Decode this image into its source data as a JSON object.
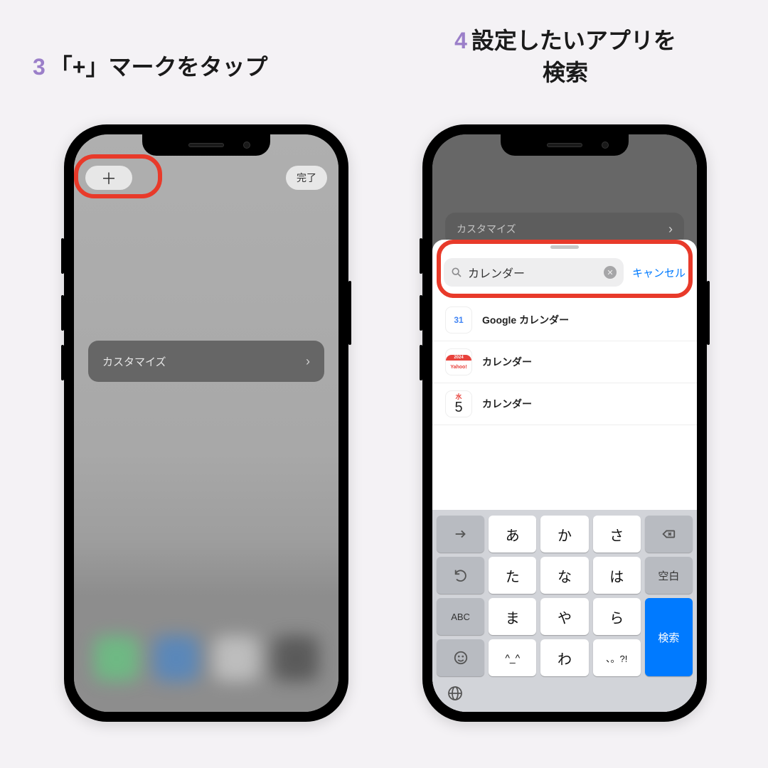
{
  "captions": {
    "step3_num": "3",
    "step3_text": "「+」マークをタップ",
    "step4_num": "4",
    "step4_text": "設定したいアプリを\n検索"
  },
  "phone1": {
    "plus_label": "＋",
    "done_label": "完了",
    "customize_label": "カスタマイズ"
  },
  "phone2": {
    "ghost_row_label": "カスタマイズ",
    "search_value": "カレンダー",
    "cancel_label": "キャンセル",
    "results": [
      {
        "label": "Google カレンダー",
        "icon": "gcal",
        "badge": "31"
      },
      {
        "label": "カレンダー",
        "icon": "ycal",
        "badge_top": "2024",
        "badge_btm": "Yahoo!"
      },
      {
        "label": "カレンダー",
        "icon": "acal",
        "day": "水",
        "num": "5"
      }
    ],
    "keyboard": {
      "rows": [
        [
          "→",
          "あ",
          "か",
          "さ",
          "⌫"
        ],
        [
          "↺",
          "た",
          "な",
          "は",
          "空白"
        ],
        [
          "ABC",
          "ま",
          "や",
          "ら",
          "検索"
        ],
        [
          "☺",
          "^_^",
          "わ",
          "、。?!",
          ""
        ]
      ],
      "arrow": "→",
      "undo": "↺",
      "abc": "ABC",
      "emoji": "☺",
      "space": "空白",
      "search": "検索",
      "kana": [
        "あ",
        "か",
        "さ",
        "た",
        "な",
        "は",
        "ま",
        "や",
        "ら",
        "^_^",
        "わ",
        "、。?!"
      ]
    }
  }
}
